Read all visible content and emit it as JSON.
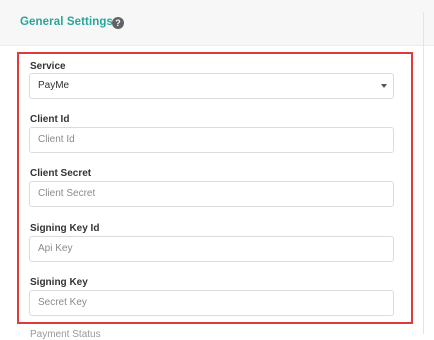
{
  "section": {
    "title": "General Settings",
    "help_icon": "question-circle-icon",
    "title_color": "#26a69a"
  },
  "highlight_color": "#e03a3a",
  "fields": [
    {
      "label": "Service",
      "value": "PayMe",
      "type": "select"
    },
    {
      "label": "Client Id",
      "placeholder": "Client Id",
      "type": "text"
    },
    {
      "label": "Client Secret",
      "placeholder": "Client Secret",
      "type": "text"
    },
    {
      "label": "Signing Key Id",
      "placeholder": "Api Key",
      "type": "text"
    },
    {
      "label": "Signing Key",
      "placeholder": "Secret Key",
      "type": "text"
    }
  ],
  "next_label": "Payment Status"
}
